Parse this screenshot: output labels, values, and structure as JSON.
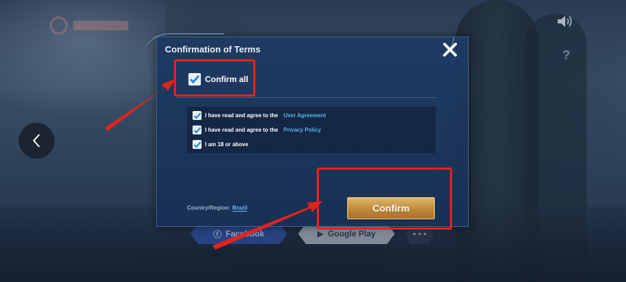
{
  "dialog": {
    "title": "Confirmation of Terms",
    "confirm_all_label": "Confirm all",
    "terms": [
      {
        "text": "I have read and agree to the",
        "link": "User Agreement"
      },
      {
        "text": "I have read and agree to the",
        "link": "Privacy Policy"
      },
      {
        "text": "I am 18 or above",
        "link": ""
      }
    ],
    "region_label": "Country/Region:",
    "region_value": "Brazil",
    "confirm_button_label": "Confirm",
    "close_icon": "close-icon"
  },
  "background": {
    "login_facebook": "Facebook",
    "login_google": "Google Play",
    "login_more": "• • •"
  },
  "colors": {
    "annotation": "#e5231d",
    "confirm_gold": "#c08a3c",
    "link_blue": "#5ab4ee"
  }
}
